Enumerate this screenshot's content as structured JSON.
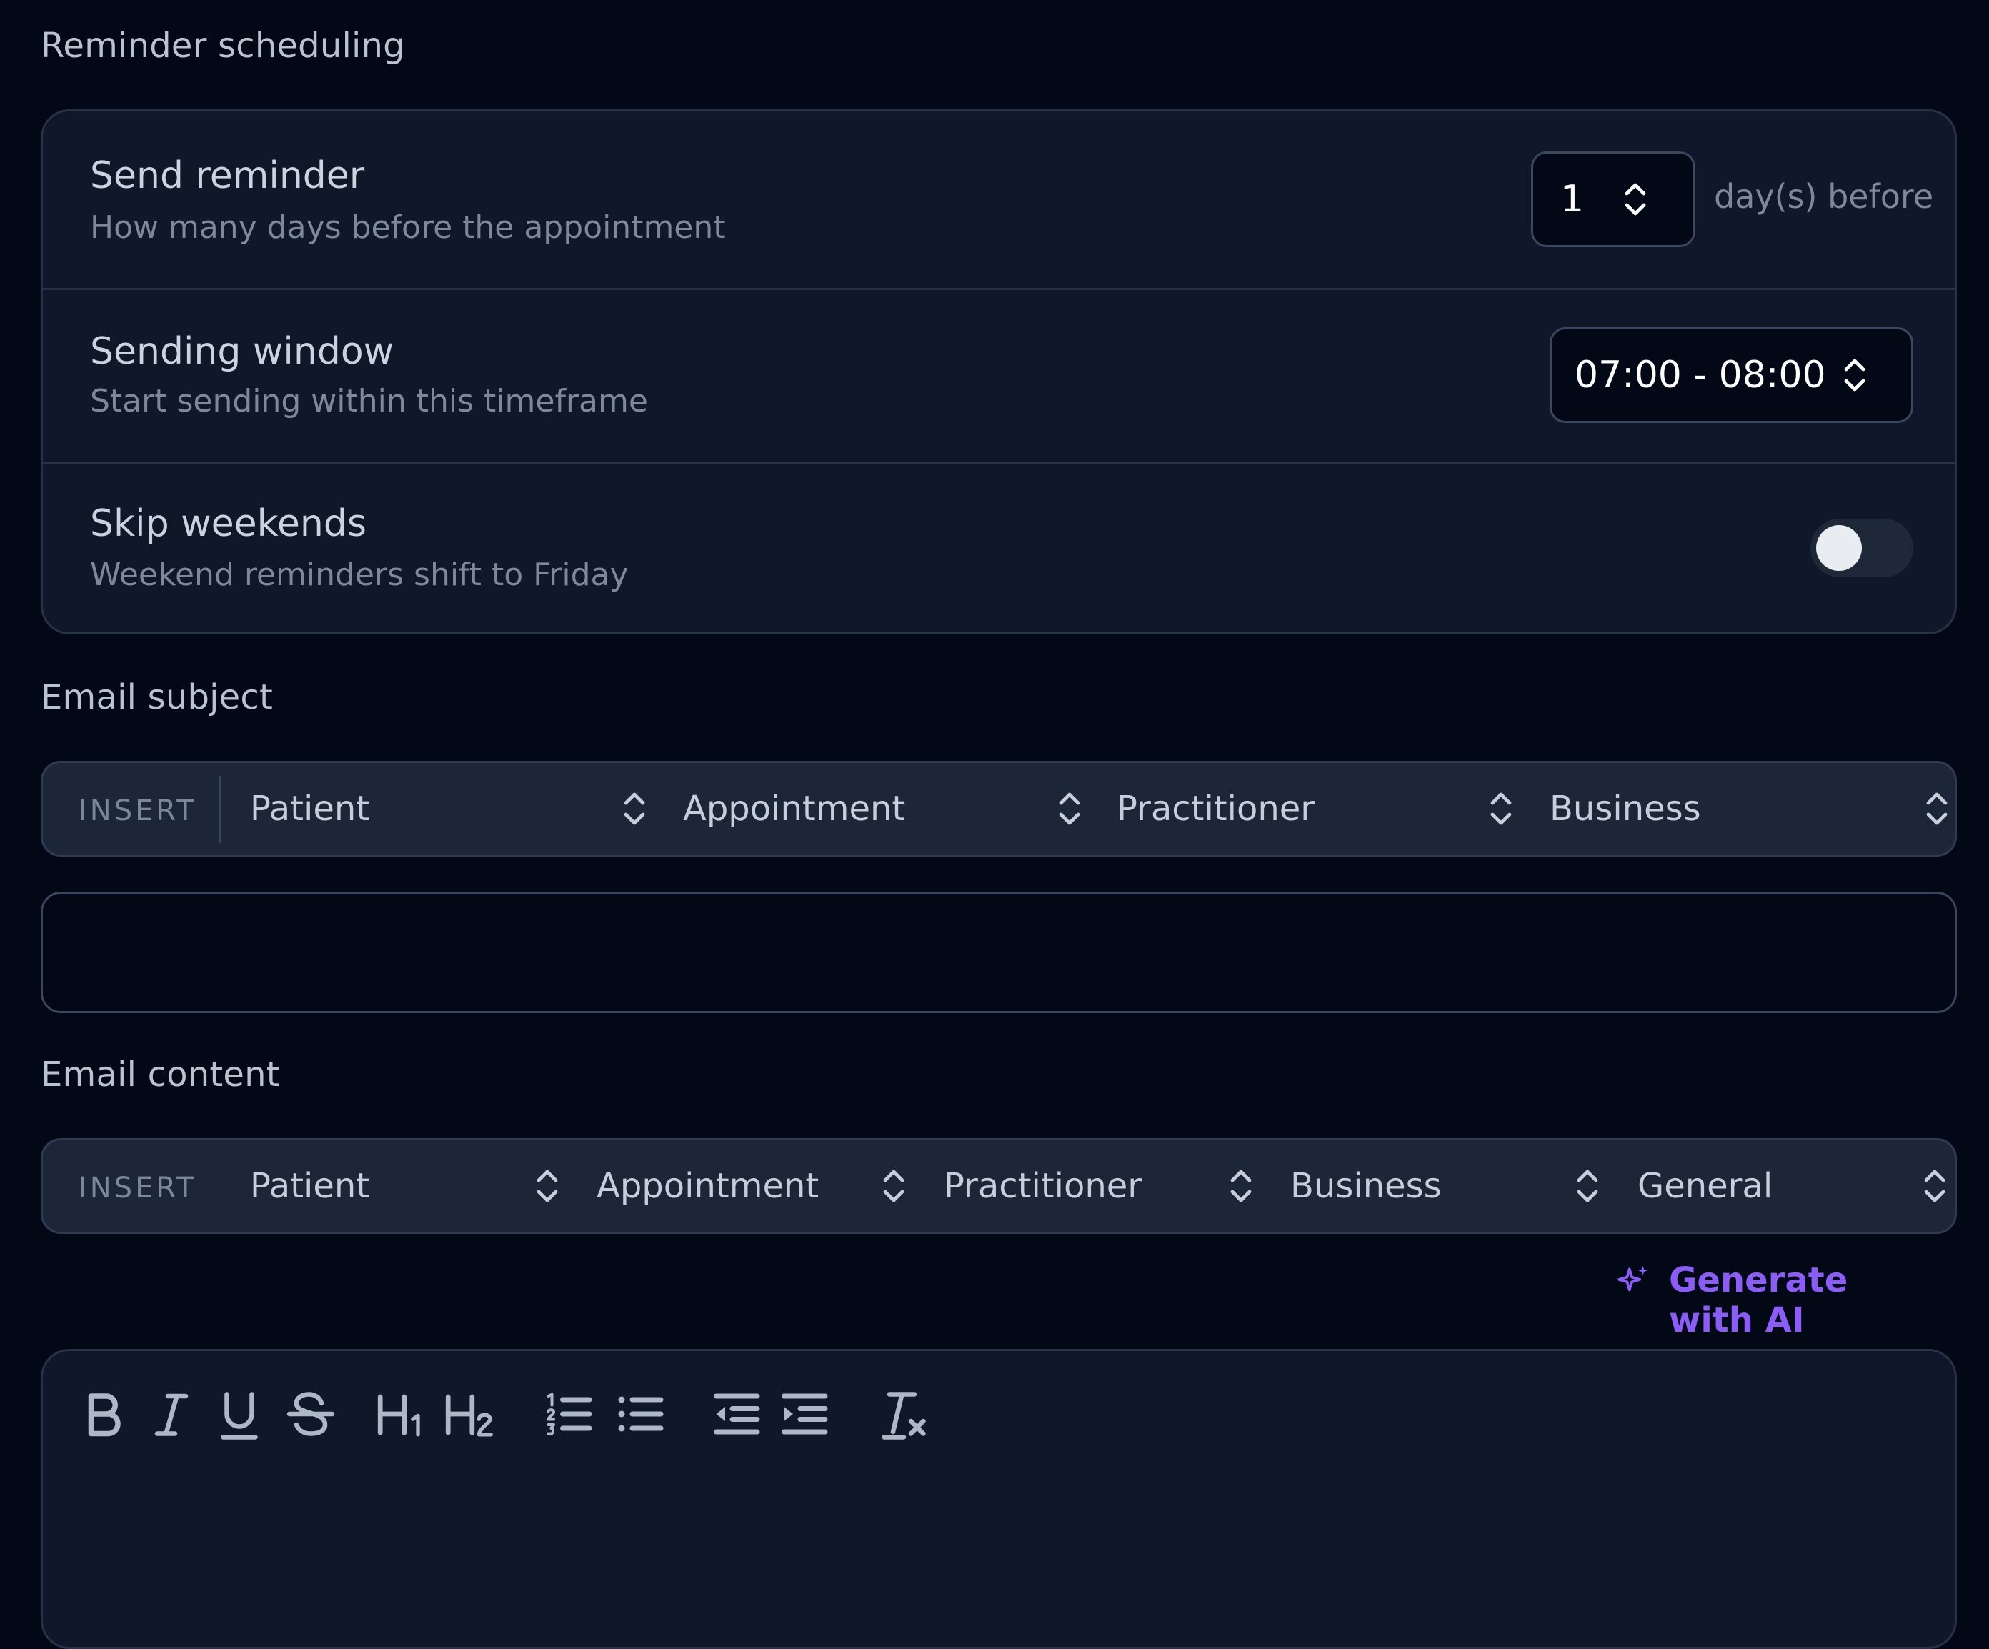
{
  "scheduling": {
    "title": "Reminder scheduling",
    "send_reminder": {
      "title": "Send reminder",
      "description": "How many days before the appointment",
      "value": "1",
      "suffix": "day(s) before"
    },
    "sending_window": {
      "title": "Sending window",
      "description": "Start sending within this timeframe",
      "value": "07:00 - 08:00"
    },
    "skip_weekends": {
      "title": "Skip weekends",
      "description": "Weekend reminders shift to Friday",
      "enabled": false
    }
  },
  "email_subject": {
    "title": "Email subject",
    "insert_label": "INSERT",
    "options": [
      "Patient",
      "Appointment",
      "Practitioner",
      "Business"
    ],
    "value": ""
  },
  "email_content": {
    "title": "Email content",
    "insert_label": "INSERT",
    "options": [
      "Patient",
      "Appointment",
      "Practitioner",
      "Business",
      "General"
    ],
    "ai_button": "Generate with AI",
    "toolbar": [
      "bold-icon",
      "italic-icon",
      "underline-icon",
      "strikethrough-icon",
      "heading-1-icon",
      "heading-2-icon",
      "ordered-list-icon",
      "bullet-list-icon",
      "outdent-icon",
      "indent-icon",
      "clear-format-icon"
    ]
  },
  "colors": {
    "background": "#030817",
    "card": "#0f1729",
    "accent": "#8b5cf6"
  }
}
